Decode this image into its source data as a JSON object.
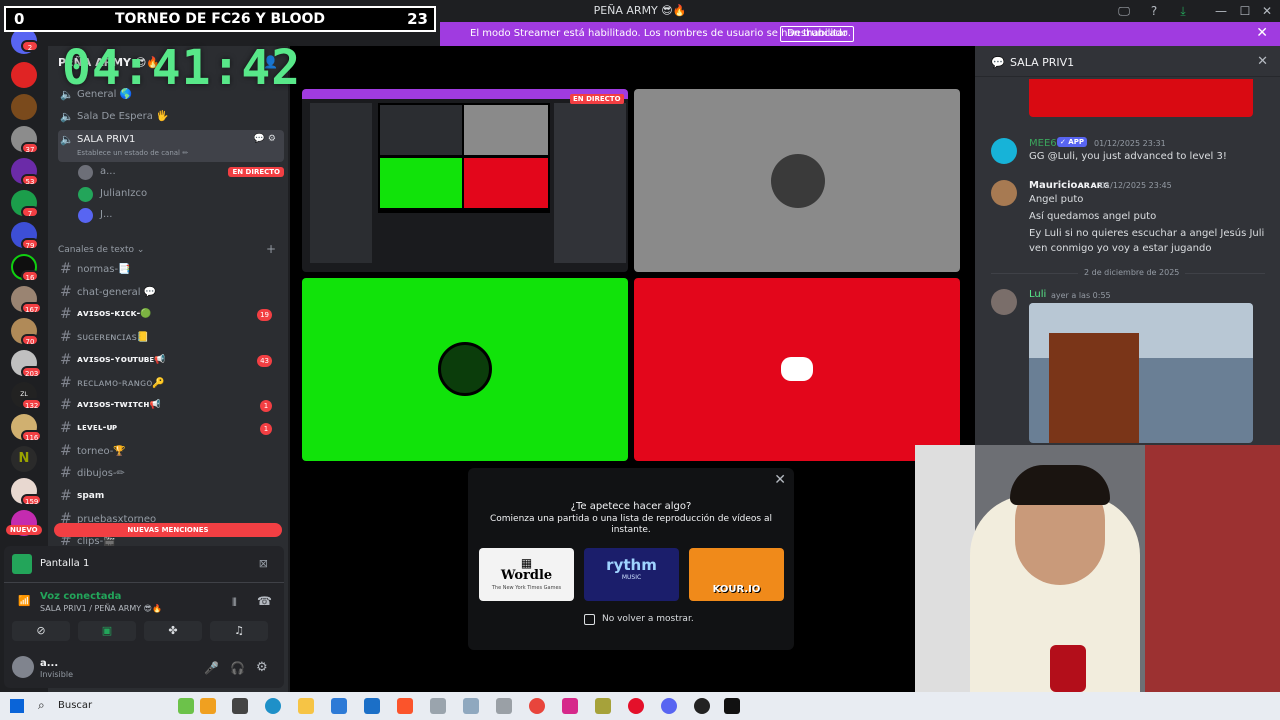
{
  "window": {
    "title": "PEÑA ARMY 😎🔥",
    "controls": [
      "🖵",
      "?",
      "⤓",
      "—",
      "☐",
      "✕"
    ]
  },
  "streamer_banner": {
    "message": "El modo Streamer está habilitado. Los nombres de usuario se han truncado.",
    "button": "Deshabilitar",
    "close": "✕"
  },
  "scoreboard": {
    "left_score": "0",
    "title": "TORNEO DE FC26 Y BLOOD",
    "right_score": "23"
  },
  "timer": "04:41:42",
  "server_rail": {
    "badges": [
      "2",
      "37",
      "53",
      "7",
      "79",
      "16",
      "167",
      "70",
      "203",
      "132",
      "116",
      "159"
    ],
    "new_label": "NUEVO",
    "zona_label": "ZL ZONA"
  },
  "sidebar": {
    "server_name": "PEÑA ARMY 😎🔥",
    "voice_channels": [
      {
        "label": "General 🌎"
      },
      {
        "label": "Sala De Espera 🖐"
      },
      {
        "label": "SALA PRIV1",
        "status": "Establece un estado de canal ✏"
      }
    ],
    "voice_users": [
      {
        "name": "a...",
        "live": "EN DIRECTO"
      },
      {
        "name": "JulianIzco"
      },
      {
        "name": "J..."
      }
    ],
    "category": "Canales de texto ⌄",
    "text_channels": [
      {
        "label": "normas-📑",
        "bold": false,
        "badge": ""
      },
      {
        "label": "chat-general 💬",
        "bold": false,
        "badge": ""
      },
      {
        "label": "ᴀᴠɪsᴏs-ᴋɪᴄᴋ-🟢",
        "bold": true,
        "badge": "19"
      },
      {
        "label": "sᴜɢᴇʀᴇɴᴄɪᴀs📒",
        "bold": false,
        "badge": ""
      },
      {
        "label": "ᴀᴠɪsᴏs-ʏᴏᴜᴛᴜʙᴇ📢",
        "bold": true,
        "badge": "43"
      },
      {
        "label": "ʀᴇᴄʟᴀᴍᴏ-ʀᴀɴɢᴏ🔑",
        "bold": false,
        "badge": ""
      },
      {
        "label": "ᴀᴠɪsᴏs-ᴛᴡɪᴛᴄʜ📢",
        "bold": true,
        "badge": "1"
      },
      {
        "label": "ʟᴇᴠᴇʟ-ᴜᴘ",
        "bold": true,
        "badge": "1"
      },
      {
        "label": "torneo-🏆",
        "bold": false,
        "badge": ""
      },
      {
        "label": "dibujos-✏",
        "bold": false,
        "badge": ""
      },
      {
        "label": "spam",
        "bold": true,
        "badge": ""
      },
      {
        "label": "pruebasxtorneo",
        "bold": false,
        "badge": ""
      },
      {
        "label": "clips-🎬",
        "bold": false,
        "badge": ""
      }
    ],
    "new_mentions": "NUEVAS MENCIONES"
  },
  "panel": {
    "screen_label": "Pantalla 1",
    "voice_status": "Voz conectada",
    "voice_channel": "SALA PRIV1 / PEÑA ARMY 😎🔥",
    "user_name": "a...",
    "user_status": "Invisible"
  },
  "main": {
    "live_label": "EN DIRECTO"
  },
  "popup": {
    "title": "¿Te apetece hacer algo?",
    "subtitle_line1": "Comienza una partida o una lista de reproducción de vídeos al",
    "subtitle_line2": "instante.",
    "games": [
      "Wordle",
      "rythm",
      "KOUR.IO"
    ],
    "wordle_sub": "The New York Times Games",
    "rythm_sub": "MUSIC",
    "checkbox_label": "No volver a mostrar.",
    "close": "✕"
  },
  "chat": {
    "channel_name": "SALA PRIV1",
    "messages": [
      {
        "author": "MEE6",
        "tag": "✓ APP",
        "time": "01/12/2025 23:31",
        "lines": [
          "GG @Luli, you just advanced to level 3!"
        ],
        "color": "#3ba55c"
      },
      {
        "author": "Mauricioᴀʀᴀʀɢ",
        "time": "01/12/2025 23:45",
        "lines": [
          "Angel puto",
          "Así quedamos angel puto",
          "Ey Luli si no quieres escuchar a angel Jesús Juli",
          "ven conmigo yo voy a estar jugando"
        ],
        "color": "#f2f3f5"
      },
      {
        "author": "Luli",
        "time": "ayer a las 0:55",
        "lines": [],
        "color": "#58e889"
      }
    ],
    "date_divider": "2 de diciembre de 2025"
  },
  "taskbar": {
    "search_placeholder": "Buscar"
  }
}
